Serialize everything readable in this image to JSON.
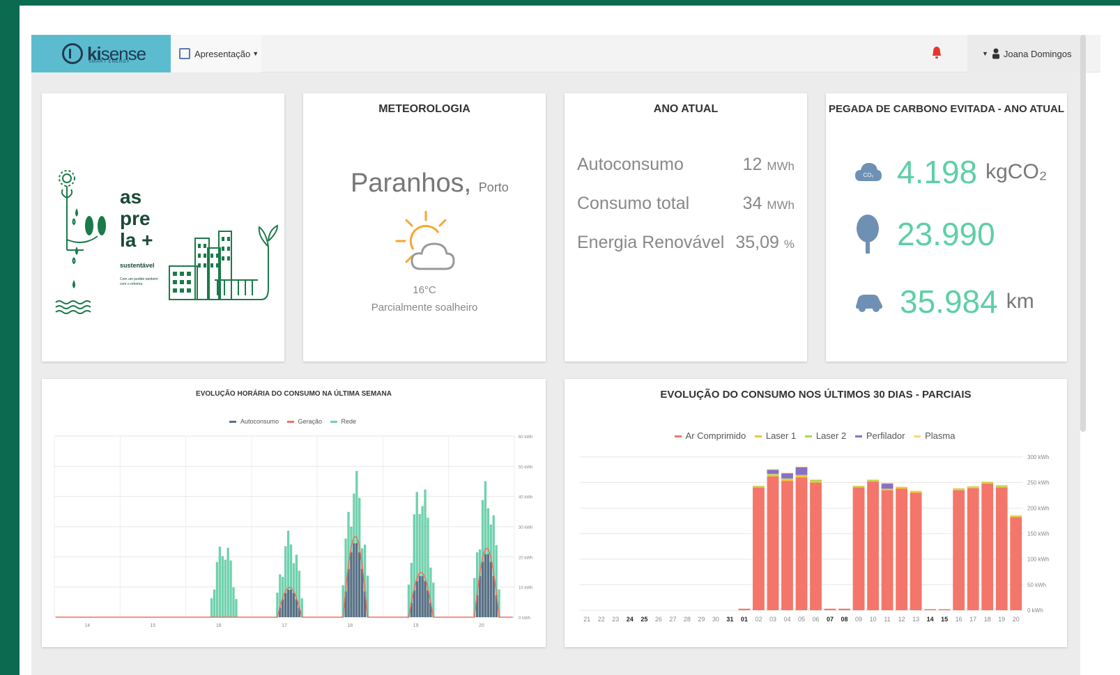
{
  "header": {
    "logo_text_bold": "ki",
    "logo_text_light": "sense",
    "logo_subtitle": "SMART ENERGY",
    "menu_label": "Apresentação",
    "user_name": "Joana Domingos"
  },
  "brand_card": {
    "tagline_1": "as",
    "tagline_2": "pre",
    "tagline_3": "la +",
    "tagline_4": "sustentável",
    "tagline_small": "Com um pedido também com o reforma"
  },
  "weather": {
    "title": "METEOROLOGIA",
    "city": "Paranhos,",
    "region": "Porto",
    "temperature": "16°C",
    "condition": "Parcialmente soalheiro",
    "icon": "sun-cloud-icon"
  },
  "year": {
    "title": "ANO ATUAL",
    "rows": [
      {
        "label": "Autoconsumo",
        "value": "12",
        "unit": "MWh"
      },
      {
        "label": "Consumo total",
        "value": "34",
        "unit": "MWh"
      },
      {
        "label": "Energia Renovável",
        "value": "35,09",
        "unit": "%"
      }
    ]
  },
  "carbon": {
    "title": "PEGADA DE CARBONO EVITADA - ANO ATUAL",
    "co2_value": "4.198",
    "co2_unit": "kgCO₂",
    "trees_value": "23.990",
    "km_value": "35.984",
    "km_unit": "km",
    "accent": "#5ecfa5"
  },
  "chart_data": [
    {
      "type": "area",
      "title": "EVOLUÇÃO HORÁRIA DO CONSUMO NA ÚLTIMA SEMANA",
      "legend": [
        "Autoconsumo",
        "Geração",
        "Rede"
      ],
      "colors": {
        "Autoconsumo": "#5a6f86",
        "Geração": "#f16e5c",
        "Rede": "#6fd1ad"
      },
      "x_ticks": [
        "14",
        "15",
        "16",
        "17",
        "18",
        "19",
        "20"
      ],
      "y_ticks": [
        "0 kWh",
        "10 kWh",
        "20 kWh",
        "30 kWh",
        "40 kWh",
        "50 kWh",
        "60 kWh"
      ],
      "ylim": [
        0,
        60
      ],
      "days": [
        {
          "day": "14",
          "rede_peak": 0,
          "gen_peak": 0
        },
        {
          "day": "15",
          "rede_peak": 0,
          "gen_peak": 0
        },
        {
          "day": "16",
          "rede_peak": 26,
          "gen_peak": 0
        },
        {
          "day": "17",
          "rede_peak": 29,
          "gen_peak": 10
        },
        {
          "day": "18",
          "rede_peak": 49,
          "gen_peak": 27
        },
        {
          "day": "19",
          "rede_peak": 47,
          "gen_peak": 15
        },
        {
          "day": "20",
          "rede_peak": 46,
          "gen_peak": 23
        }
      ]
    },
    {
      "type": "bar",
      "title": "EVOLUÇÃO DO CONSUMO NOS ÚLTIMOS 30 DIAS - PARCIAIS",
      "categories": [
        "21",
        "22",
        "23",
        "24",
        "25",
        "26",
        "27",
        "28",
        "29",
        "30",
        "31",
        "01",
        "02",
        "03",
        "04",
        "05",
        "06",
        "07",
        "08",
        "09",
        "10",
        "11",
        "12",
        "13",
        "14",
        "15",
        "16",
        "17",
        "18",
        "19",
        "20"
      ],
      "bold_categories": [
        "24",
        "25",
        "31",
        "01",
        "07",
        "08",
        "14",
        "15"
      ],
      "y_ticks": [
        "0 kWh",
        "50 kWh",
        "100 kWh",
        "150 kWh",
        "200 kWh",
        "250 kWh",
        "300 kWh"
      ],
      "ylim": [
        0,
        300
      ],
      "series": [
        {
          "name": "Ar Comprimido",
          "color": "#f4766a",
          "values": [
            0,
            0,
            0,
            0,
            0,
            0,
            0,
            0,
            0,
            0,
            0,
            3,
            240,
            262,
            253,
            260,
            250,
            3,
            3,
            240,
            252,
            235,
            238,
            230,
            2,
            2,
            235,
            239,
            248,
            240,
            182
          ]
        },
        {
          "name": "Laser 1",
          "color": "#f4c430",
          "values": [
            0,
            0,
            0,
            0,
            0,
            0,
            0,
            0,
            0,
            0,
            0,
            0,
            2,
            3,
            3,
            3,
            3,
            0,
            0,
            2,
            2,
            2,
            2,
            2,
            0,
            0,
            2,
            2,
            2,
            2,
            2
          ]
        },
        {
          "name": "Laser 2",
          "color": "#a8d85a",
          "values": [
            0,
            0,
            0,
            0,
            0,
            0,
            0,
            0,
            0,
            0,
            0,
            0,
            1,
            2,
            2,
            2,
            2,
            0,
            0,
            1,
            1,
            1,
            1,
            1,
            0,
            0,
            1,
            1,
            1,
            2,
            1
          ]
        },
        {
          "name": "Perfilador",
          "color": "#8a6fc4",
          "values": [
            0,
            0,
            0,
            0,
            0,
            0,
            0,
            0,
            0,
            0,
            0,
            0,
            0,
            8,
            10,
            15,
            0,
            0,
            0,
            0,
            0,
            10,
            0,
            0,
            0,
            0,
            0,
            0,
            0,
            0,
            0
          ]
        },
        {
          "name": "Plasma",
          "color": "#f9d980",
          "values": [
            0,
            0,
            0,
            0,
            0,
            0,
            0,
            0,
            0,
            0,
            0,
            0,
            1,
            1,
            1,
            1,
            1,
            0,
            0,
            1,
            1,
            1,
            1,
            1,
            0,
            0,
            1,
            1,
            1,
            1,
            1
          ]
        }
      ]
    }
  ]
}
